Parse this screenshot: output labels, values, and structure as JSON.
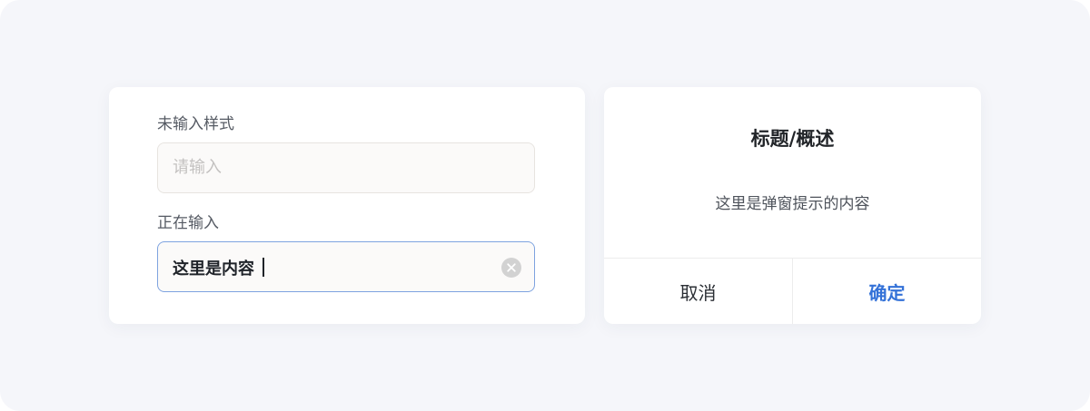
{
  "colors": {
    "background": "#f5f6fa",
    "card": "#ffffff",
    "input_fill": "#fbfaf9",
    "input_border_idle": "#e7e4e0",
    "input_border_focus": "#7ea3e0",
    "text_primary": "#1f2329",
    "placeholder": "#c3c1c0",
    "accent": "#3472d8"
  },
  "form": {
    "unfilled_label": "未输入样式",
    "unfilled_input": {
      "placeholder": "请输入",
      "value": ""
    },
    "typing_label": "正在输入",
    "typing_input": {
      "value": "这里是内容",
      "clear_icon": "clear-circle-icon"
    }
  },
  "dialog": {
    "title": "标题/概述",
    "message": "这里是弹窗提示的内容",
    "cancel_label": "取消",
    "confirm_label": "确定"
  }
}
